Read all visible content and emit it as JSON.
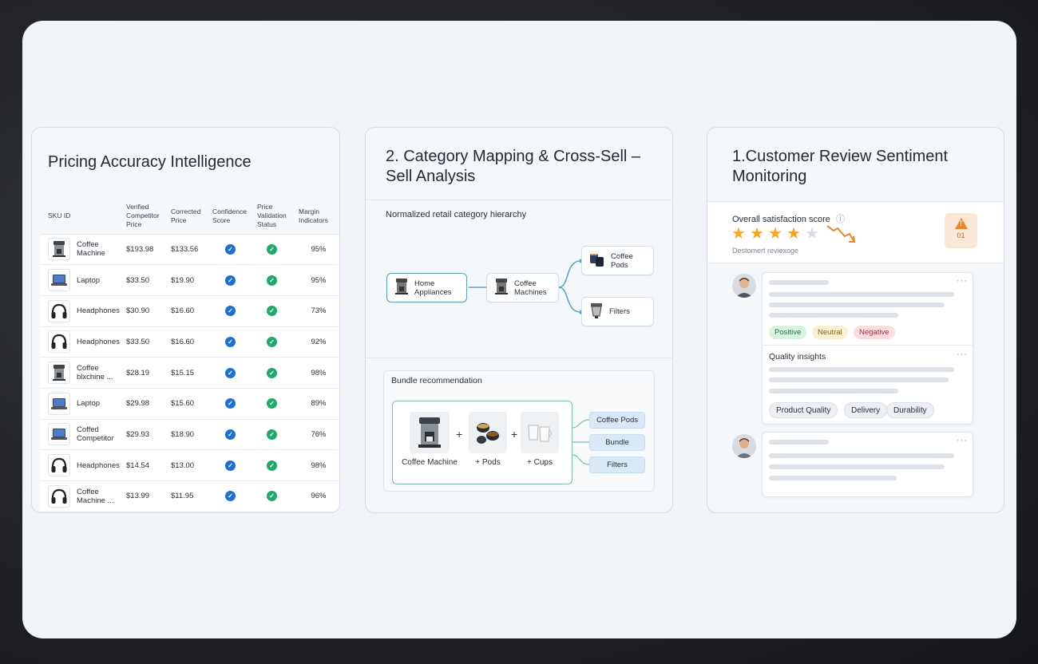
{
  "pricing": {
    "title": "Pricing Accuracy Intelligence",
    "headers": [
      "SKU ID",
      "Verified Competitor Price",
      "Corrected Price",
      "Confidence Score",
      "Price Validation Status",
      "Margin Indicators"
    ],
    "rows": [
      {
        "name": "Coffee Machine",
        "icon": "coffee-machine",
        "competitor": "$193.98",
        "corrected": "$133.56",
        "margin": "95%"
      },
      {
        "name": "Laptop",
        "icon": "laptop",
        "competitor": "$33.50",
        "corrected": "$19.90",
        "margin": "95%"
      },
      {
        "name": "Headphones",
        "icon": "headphones",
        "competitor": "$30.90",
        "corrected": "$16.60",
        "margin": "73%"
      },
      {
        "name": "Headphones",
        "icon": "headphones",
        "competitor": "$33.50",
        "corrected": "$16.60",
        "margin": "92%"
      },
      {
        "name": "Coffee blxchine ...",
        "icon": "coffee-machine",
        "competitor": "$28.19",
        "corrected": "$15.15",
        "margin": "98%"
      },
      {
        "name": "Laptop",
        "icon": "laptop",
        "competitor": "$29.98",
        "corrected": "$15.60",
        "margin": "89%"
      },
      {
        "name": "Coffed Competitor",
        "icon": "laptop",
        "competitor": "$29.93",
        "corrected": "$18.90",
        "margin": "76%"
      },
      {
        "name": "Headphones",
        "icon": "headphones",
        "competitor": "$14.54",
        "corrected": "$13.00",
        "margin": "98%"
      },
      {
        "name": "Coffee Machine ...",
        "icon": "headphones",
        "competitor": "$13.99",
        "corrected": "$11.95",
        "margin": "96%"
      }
    ]
  },
  "category": {
    "title": "2. Category Mapping & Cross-Sell – Sell Analysis",
    "hierarchy_label": "Normalized retail category hierarchy",
    "nodes": {
      "root": "Home Appliances",
      "mid": "Coffee Machines",
      "leaf1": "Coffee Pods",
      "leaf2": "Filters"
    },
    "bundle_label": "Bundle recommendation",
    "bundle_items": [
      "Coffee Machine",
      "+ Pods",
      "+ Cups"
    ],
    "plus": "+",
    "bundle_pills": [
      "Coffee Pods",
      "Bundle",
      "Filters"
    ]
  },
  "sentiment": {
    "title": "1.Customer Review Sentiment Monitoring",
    "score_label": "Overall satisfaction score",
    "info_icon": "ⓘ",
    "stars_rating": 4,
    "stars_total": 5,
    "score_sub": "Destomert reviexoge",
    "alert_icon": "!",
    "alert_count": "01",
    "tags": [
      "Positive",
      "Neutral",
      "Negative"
    ],
    "insights_label": "Quality insights",
    "chips": [
      "Product Quality",
      "Delivery",
      "Durability"
    ],
    "more": "···"
  },
  "colors": {
    "check_blue": "#1f6fd1",
    "check_green": "#22a86a",
    "star": "#f5a623",
    "alert": "#e8842a"
  }
}
